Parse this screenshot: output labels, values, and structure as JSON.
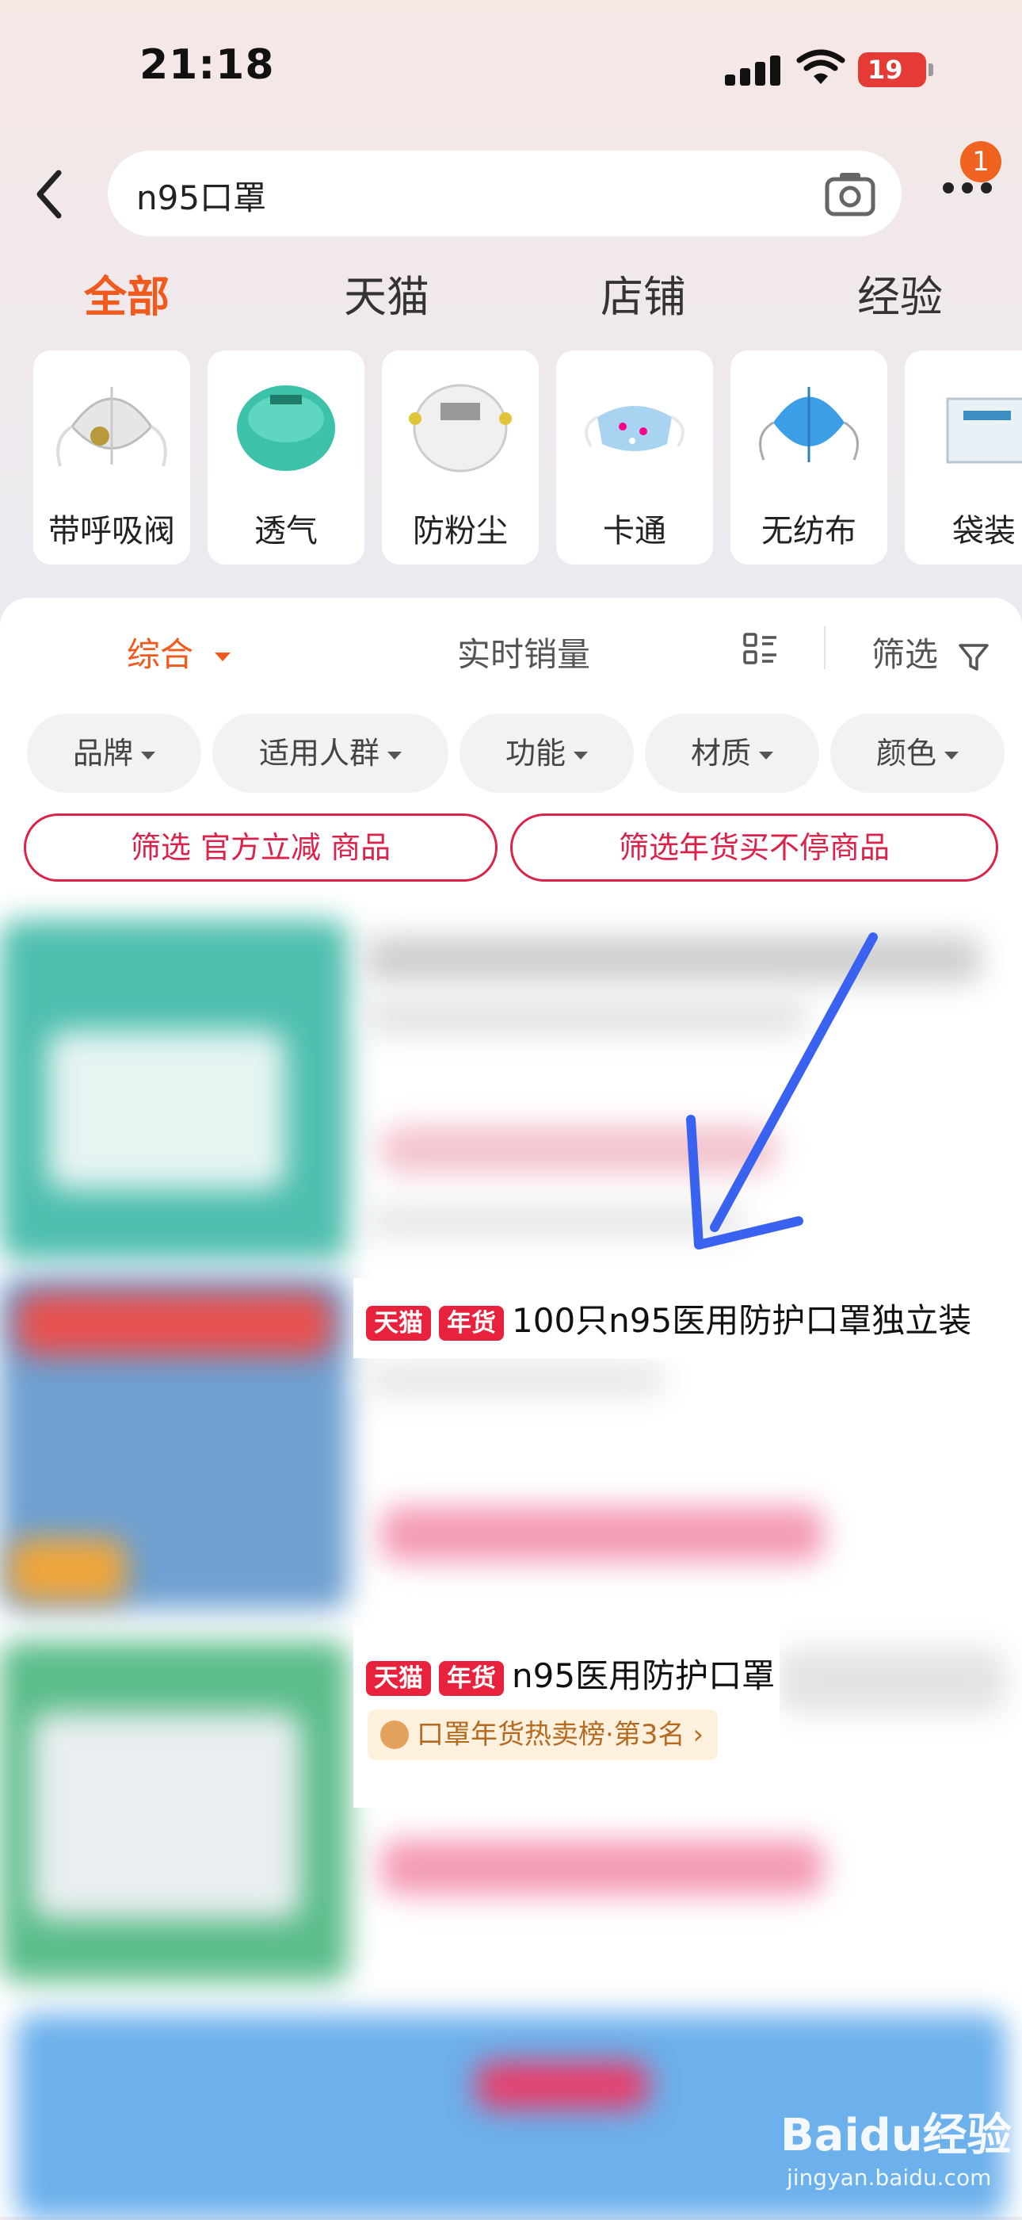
{
  "status_bar": {
    "time": "21:18",
    "battery": "19"
  },
  "search": {
    "query": "n95口罩",
    "notification_count": "1"
  },
  "tabs": [
    "全部",
    "天猫",
    "店铺",
    "经验"
  ],
  "categories": [
    "带呼吸阀",
    "透气",
    "防粉尘",
    "卡通",
    "无纺布",
    "袋装"
  ],
  "sort_bar": {
    "composite": "综合",
    "realtime_sales": "实时销量",
    "filter": "筛选"
  },
  "filter_chips": [
    "品牌",
    "适用人群",
    "功能",
    "材质",
    "颜色"
  ],
  "promo_buttons": [
    "筛选 官方立减 商品",
    "筛选年货买不停商品"
  ],
  "products": [
    {
      "tags": [
        "天猫",
        "年货"
      ],
      "title": "100只n95医用防护口罩独立装"
    },
    {
      "tags": [
        "天猫",
        "年货"
      ],
      "title": "n95医用防护口罩",
      "rank_label": "口罩年货热卖榜·第3名"
    }
  ],
  "watermark": {
    "brand": "Baidu经验",
    "url": "jingyan.baidu.com"
  },
  "colors": {
    "accent": "#f05a1c",
    "tag_red": "#e8223c",
    "promo_border": "#d9234a",
    "annotation_arrow": "#3a62f0"
  }
}
